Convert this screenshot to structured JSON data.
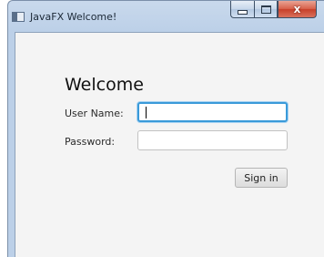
{
  "window": {
    "title": "JavaFX Welcome!",
    "icon": "java-app-icon",
    "caption_buttons": {
      "minimize_icon": "minimize-icon",
      "maximize_icon": "maximize-icon",
      "close_icon": "close-icon",
      "close_glyph": "x"
    }
  },
  "form": {
    "heading": "Welcome",
    "username_label": "User Name:",
    "username_value": "",
    "password_label": "Password:",
    "password_value": "",
    "signin_label": "Sign in"
  },
  "colors": {
    "focus_accent": "#3a9ad9",
    "close_button": "#c7402a",
    "client_background": "#f4f4f4"
  }
}
